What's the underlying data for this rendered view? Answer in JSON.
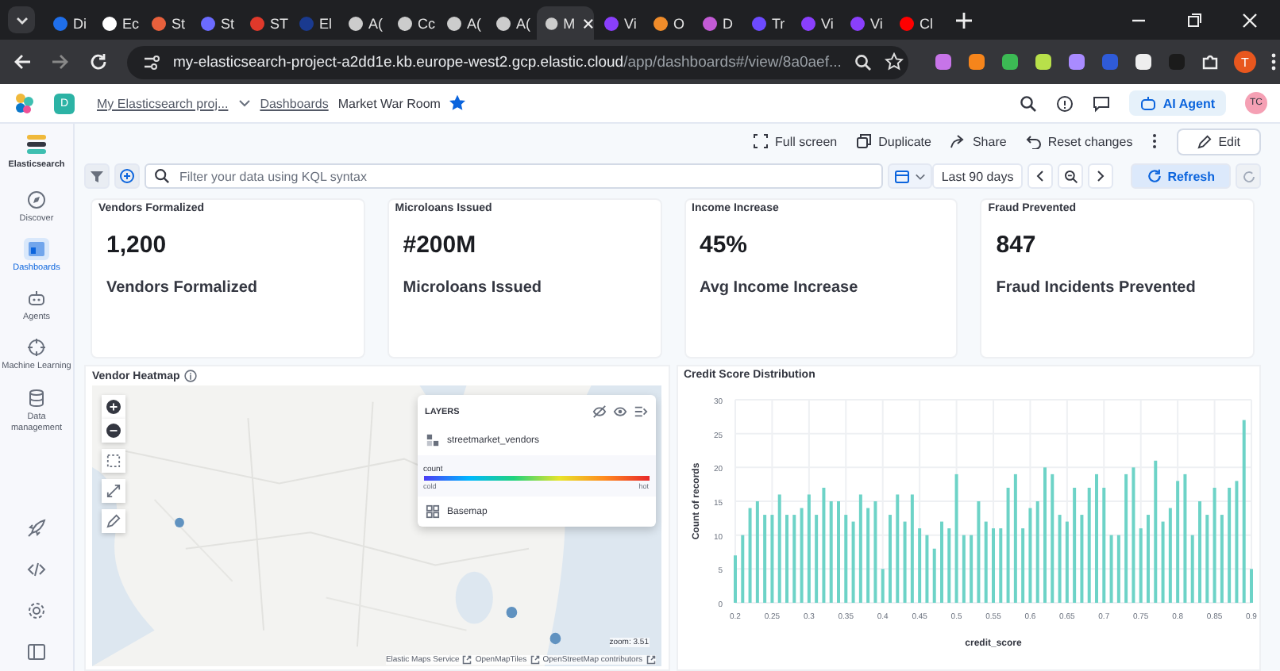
{
  "browser": {
    "tabs": [
      {
        "label": "Di",
        "selected": false
      },
      {
        "label": "Ec",
        "selected": false
      },
      {
        "label": "St",
        "selected": false
      },
      {
        "label": "St",
        "selected": false
      },
      {
        "label": "ST",
        "selected": false
      },
      {
        "label": "El",
        "selected": false
      },
      {
        "label": "A(",
        "selected": false
      },
      {
        "label": "Cc",
        "selected": false
      },
      {
        "label": "A(",
        "selected": false
      },
      {
        "label": "A(",
        "selected": false
      },
      {
        "label": "M",
        "selected": true
      },
      {
        "label": "Vi",
        "selected": false
      },
      {
        "label": "O",
        "selected": false
      },
      {
        "label": "D",
        "selected": false
      },
      {
        "label": "Tr",
        "selected": false
      },
      {
        "label": "Vi",
        "selected": false
      },
      {
        "label": "Vi",
        "selected": false
      },
      {
        "label": "Cl",
        "selected": false
      }
    ],
    "url": {
      "host": "my-elasticsearch-project-a2dd1e.kb.europe-west2.gcp.elastic.cloud",
      "path": "/app/dashboards#/view/8a0aef..."
    },
    "profile_initial": "T"
  },
  "header": {
    "space_initial": "D",
    "breadcrumbs": [
      "My Elasticsearch proj...",
      "Dashboards",
      "Market War Room"
    ],
    "favorite": true,
    "ai_button": "AI Agent",
    "avatar": "TC"
  },
  "sidebar": {
    "title": "Elasticsearch",
    "items": [
      {
        "label": "Discover",
        "selected": false
      },
      {
        "label": "Dashboards",
        "selected": true
      },
      {
        "label": "Agents",
        "selected": false
      },
      {
        "label": "Machine Learning",
        "selected": false
      },
      {
        "label": "Data management",
        "selected": false
      }
    ]
  },
  "toolbar": {
    "actions": [
      "Full screen",
      "Duplicate",
      "Share",
      "Reset changes"
    ],
    "edit": "Edit"
  },
  "query": {
    "placeholder": "Filter your data using KQL syntax",
    "time_range": "Last 90 days",
    "refresh": "Refresh"
  },
  "metrics": [
    {
      "title": "Vendors Formalized",
      "value": "1,200",
      "label": "Vendors Formalized"
    },
    {
      "title": "Microloans Issued",
      "value": "#200M",
      "label": "Microloans Issued"
    },
    {
      "title": "Income Increase",
      "value": "45%",
      "label": "Avg Income Increase"
    },
    {
      "title": "Fraud Prevented",
      "value": "847",
      "label": "Fraud Incidents Prevented"
    }
  ],
  "map_panel": {
    "title": "Vendor Heatmap",
    "layers": {
      "heading": "LAYERS",
      "layer": "streetmarket_vendors",
      "legend": {
        "title": "count",
        "low": "cold",
        "high": "hot"
      },
      "basemap": "Basemap"
    },
    "zoom": "zoom: 3.51",
    "attribution": [
      "Elastic Maps Service",
      "OpenMapTiles",
      "OpenStreetMap contributors"
    ]
  },
  "chart_panel": {
    "title": "Credit Score Distribution",
    "chart_data": {
      "type": "bar",
      "xlabel": "credit_score",
      "ylabel": "Count of records",
      "xlim": [
        0.2,
        0.9
      ],
      "ylim": [
        0,
        30
      ],
      "xticks": [
        {
          "value": 0.2,
          "label": "0.2"
        },
        {
          "value": 0.25,
          "label": "0.25"
        },
        {
          "value": 0.3,
          "label": "0.3"
        },
        {
          "value": 0.35,
          "label": "0.35"
        },
        {
          "value": 0.4,
          "label": "0.4"
        },
        {
          "value": 0.45,
          "label": "0.45"
        },
        {
          "value": 0.5,
          "label": "0.5"
        },
        {
          "value": 0.55,
          "label": "0.55"
        },
        {
          "value": 0.6,
          "label": "0.6"
        },
        {
          "value": 0.65,
          "label": "0.65"
        },
        {
          "value": 0.7,
          "label": "0.7"
        },
        {
          "value": 0.75,
          "label": "0.75"
        },
        {
          "value": 0.8,
          "label": "0.8"
        },
        {
          "value": 0.85,
          "label": "0.85"
        },
        {
          "value": 0.9,
          "label": "0.9"
        }
      ],
      "yticks": [
        0,
        5,
        10,
        15,
        20,
        25,
        30
      ],
      "x": [
        0.2,
        0.21,
        0.22,
        0.23,
        0.24,
        0.25,
        0.26,
        0.27,
        0.28,
        0.29,
        0.3,
        0.31,
        0.32,
        0.33,
        0.34,
        0.35,
        0.36,
        0.37,
        0.38,
        0.39,
        0.4,
        0.41,
        0.42,
        0.43,
        0.44,
        0.45,
        0.46,
        0.47,
        0.48,
        0.49,
        0.5,
        0.51,
        0.52,
        0.53,
        0.54,
        0.55,
        0.56,
        0.57,
        0.58,
        0.59,
        0.6,
        0.61,
        0.62,
        0.63,
        0.64,
        0.65,
        0.66,
        0.67,
        0.68,
        0.69,
        0.7,
        0.71,
        0.72,
        0.73,
        0.74,
        0.75,
        0.76,
        0.77,
        0.78,
        0.79,
        0.8,
        0.81,
        0.82,
        0.83,
        0.84,
        0.85,
        0.86,
        0.87,
        0.88,
        0.89,
        0.9
      ],
      "grid": true,
      "series": [
        {
          "color": "#6dd3c7",
          "values": [
            7,
            10,
            14,
            15,
            13,
            13,
            16,
            13,
            13,
            14,
            16,
            13,
            17,
            15,
            15,
            13,
            12,
            16,
            14,
            15,
            5,
            13,
            16,
            12,
            16,
            11,
            10,
            8,
            12,
            11,
            19,
            10,
            10,
            15,
            12,
            11,
            11,
            17,
            19,
            11,
            14,
            15,
            20,
            19,
            13,
            12,
            17,
            13,
            17,
            19,
            17,
            10,
            10,
            19,
            20,
            11,
            13,
            21,
            12,
            14,
            18,
            19,
            10,
            15,
            13,
            17,
            13,
            17,
            18,
            27,
            5
          ]
        }
      ]
    }
  }
}
